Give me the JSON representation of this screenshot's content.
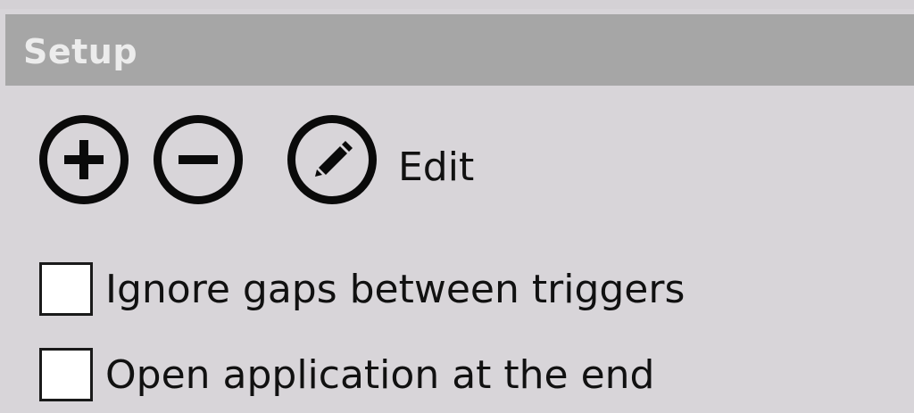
{
  "panel": {
    "title": "Setup"
  },
  "toolbar": {
    "add_icon": "plus-circle-icon",
    "remove_icon": "minus-circle-icon",
    "edit_icon": "pencil-circle-icon",
    "edit_label": "Edit"
  },
  "options": [
    {
      "label": "Ignore gaps between triggers",
      "checked": false
    },
    {
      "label": "Open application at the end",
      "checked": false
    }
  ],
  "colors": {
    "background": "#d8d5d9",
    "header": "#a6a6a6",
    "header_text": "#ececec",
    "icon": "#0a0a0a"
  }
}
